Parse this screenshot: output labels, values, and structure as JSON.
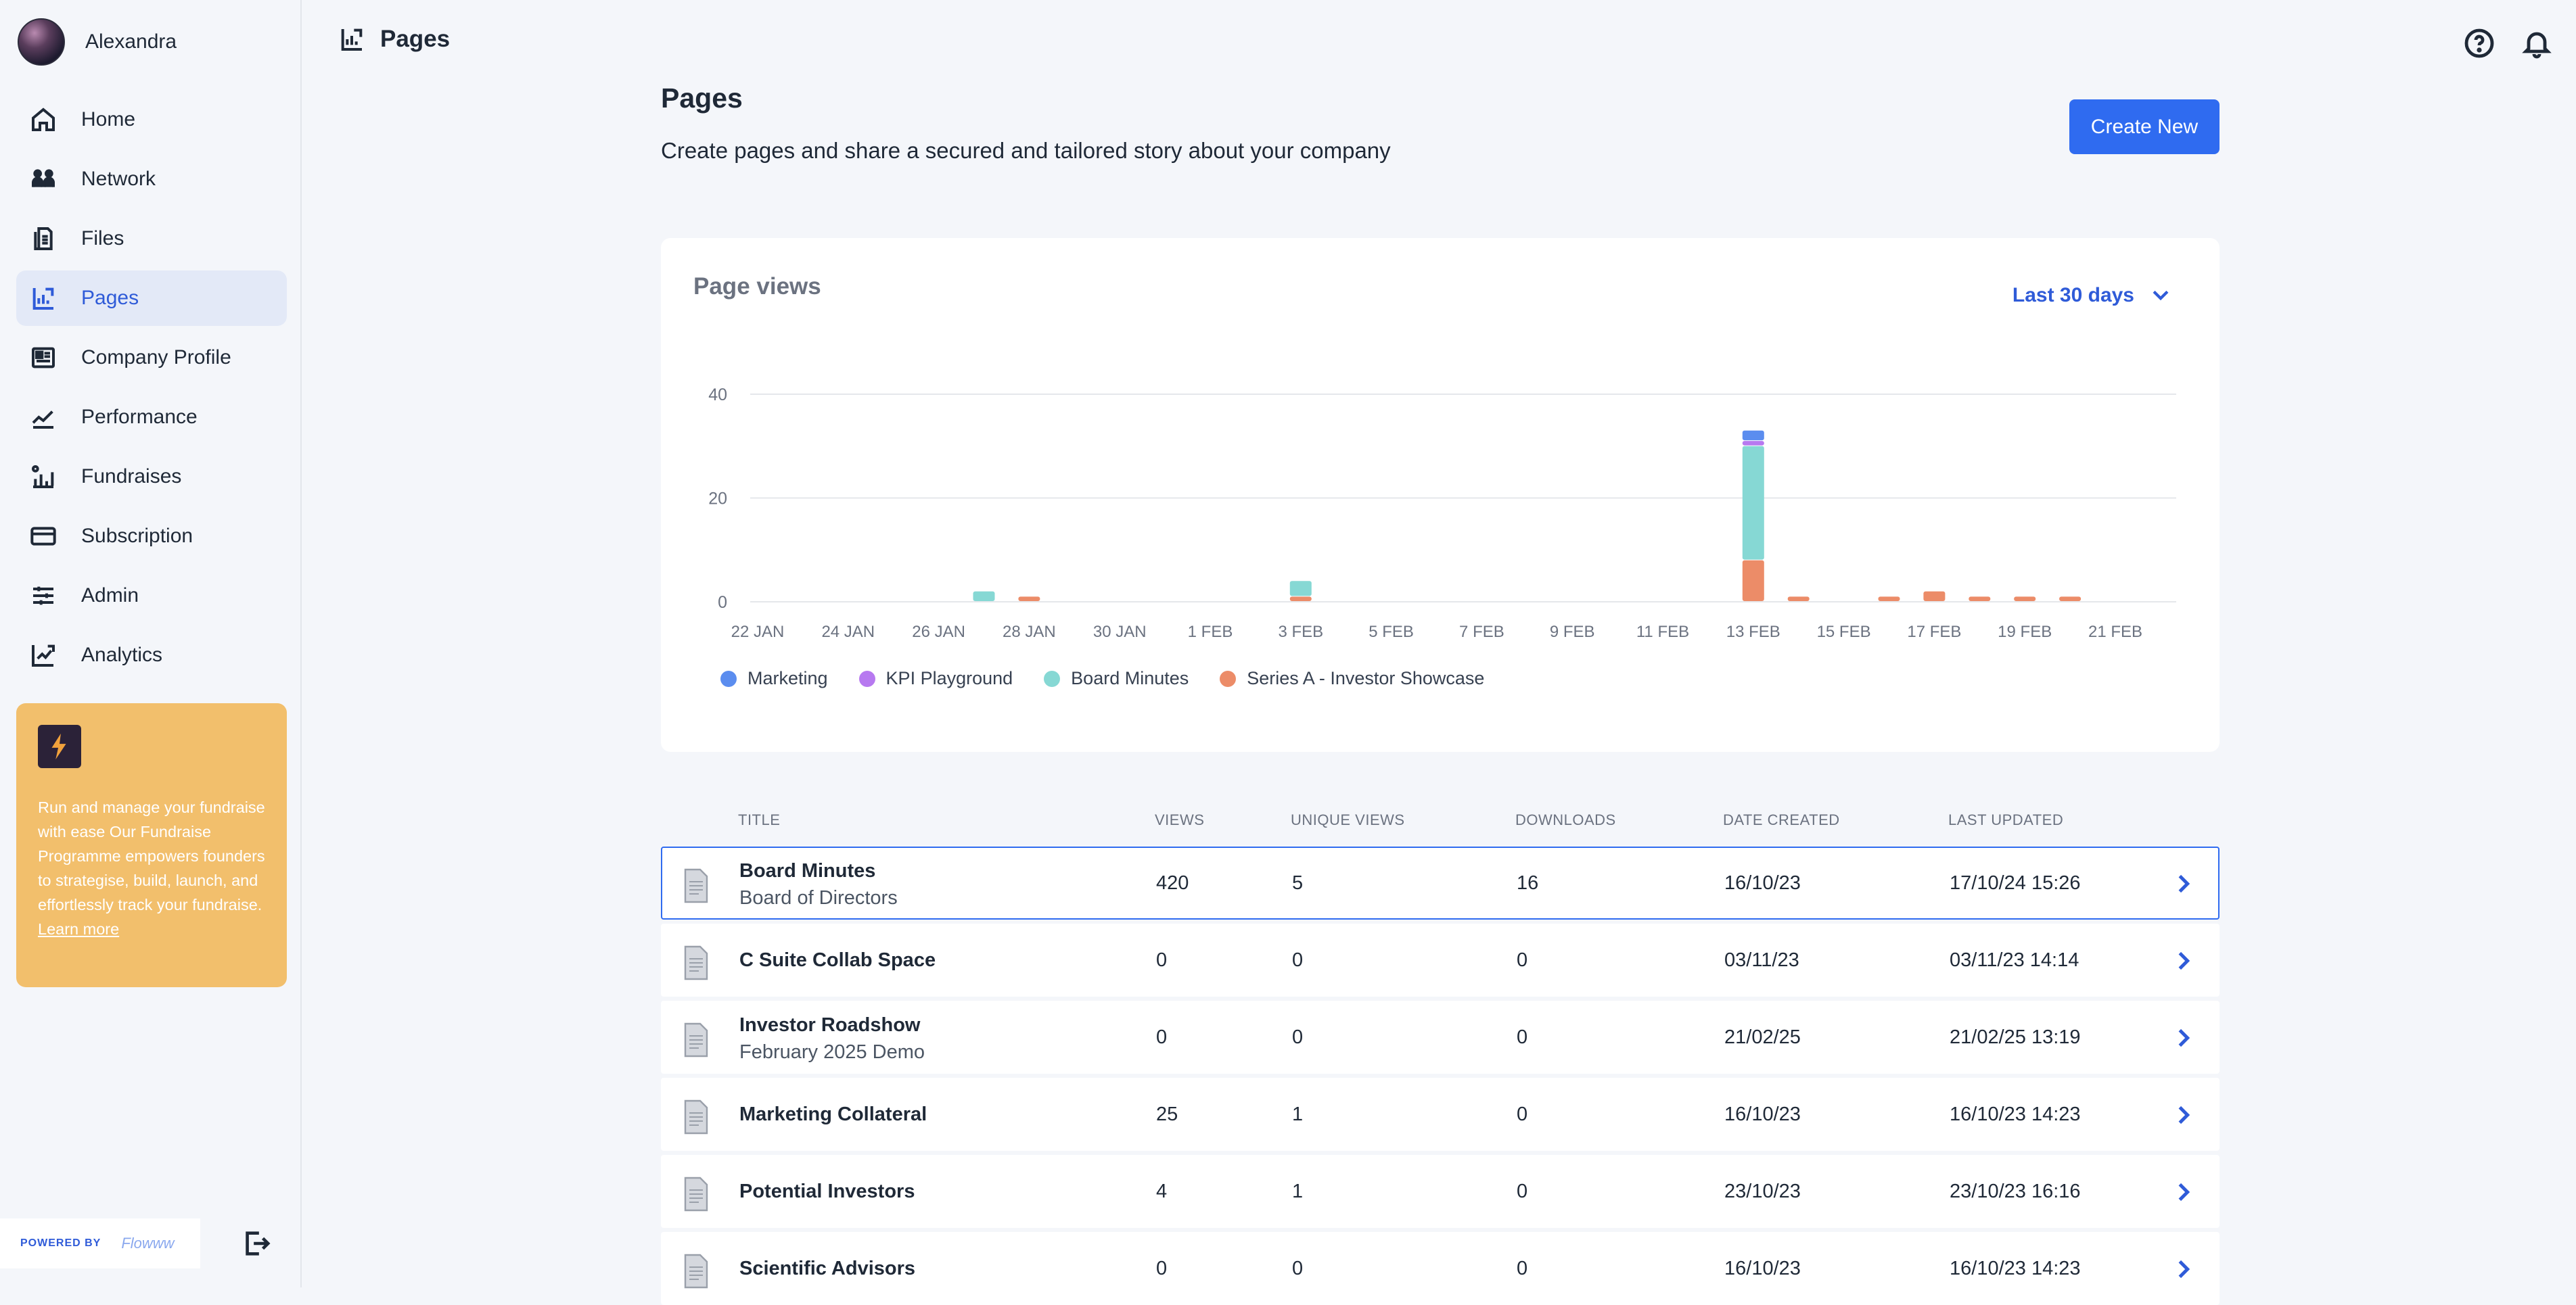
{
  "user": {
    "name": "Alexandra"
  },
  "sidebar": {
    "items": [
      {
        "label": "Home",
        "icon": "home-icon"
      },
      {
        "label": "Network",
        "icon": "network-icon"
      },
      {
        "label": "Files",
        "icon": "files-icon"
      },
      {
        "label": "Pages",
        "icon": "pages-icon",
        "active": true
      },
      {
        "label": "Company Profile",
        "icon": "company-profile-icon"
      },
      {
        "label": "Performance",
        "icon": "performance-icon"
      },
      {
        "label": "Fundraises",
        "icon": "fundraises-icon"
      },
      {
        "label": "Subscription",
        "icon": "subscription-icon"
      },
      {
        "label": "Admin",
        "icon": "admin-icon"
      },
      {
        "label": "Analytics",
        "icon": "analytics-icon"
      }
    ],
    "promo": {
      "text": "Run and manage your fundraise with ease Our Fundraise Programme empowers founders to strategise, build, launch, and effortlessly track your fundraise.",
      "link": "Learn more"
    },
    "powered_by": "POWERED BY",
    "brand": "Flowww"
  },
  "topbar": {
    "title": "Pages"
  },
  "header": {
    "title": "Pages",
    "subtitle": "Create pages and share a secured and tailored story about your company",
    "create_label": "Create New"
  },
  "chart_card": {
    "title": "Page views",
    "range_label": "Last 30 days"
  },
  "colors": {
    "accent": "#2f6bf0",
    "marketing": "#5b8def",
    "kpi_playground": "#b779f0",
    "board_minutes": "#86d8d4",
    "series_a": "#ec8c68"
  },
  "chart_data": {
    "type": "bar",
    "stacked": true,
    "categories": [
      "22 JAN",
      "23 JAN",
      "24 JAN",
      "25 JAN",
      "26 JAN",
      "27 JAN",
      "28 JAN",
      "29 JAN",
      "30 JAN",
      "31 JAN",
      "1 FEB",
      "2 FEB",
      "3 FEB",
      "4 FEB",
      "5 FEB",
      "6 FEB",
      "7 FEB",
      "8 FEB",
      "9 FEB",
      "10 FEB",
      "11 FEB",
      "12 FEB",
      "13 FEB",
      "14 FEB",
      "15 FEB",
      "16 FEB",
      "17 FEB",
      "18 FEB",
      "19 FEB",
      "20 FEB",
      "21 FEB"
    ],
    "tick_labels": [
      "22 JAN",
      "24 JAN",
      "26 JAN",
      "28 JAN",
      "30 JAN",
      "1 FEB",
      "3 FEB",
      "5 FEB",
      "7 FEB",
      "9 FEB",
      "11 FEB",
      "13 FEB",
      "15 FEB",
      "17 FEB",
      "19 FEB",
      "21 FEB"
    ],
    "series": [
      {
        "name": "Series A - Investor Showcase",
        "color": "#ec8c68",
        "values": [
          0,
          0,
          0,
          0,
          0,
          0,
          1,
          0,
          0,
          0,
          0,
          0,
          1,
          0,
          0,
          0,
          0,
          0,
          0,
          0,
          0,
          0,
          8,
          1,
          0,
          1,
          2,
          1,
          1,
          1,
          0
        ]
      },
      {
        "name": "Board Minutes",
        "color": "#86d8d4",
        "values": [
          0,
          0,
          0,
          0,
          0,
          2,
          0,
          0,
          0,
          0,
          0,
          0,
          3,
          0,
          0,
          0,
          0,
          0,
          0,
          0,
          0,
          0,
          22,
          0,
          0,
          0,
          0,
          0,
          0,
          0,
          0
        ]
      },
      {
        "name": "KPI Playground",
        "color": "#b779f0",
        "values": [
          0,
          0,
          0,
          0,
          0,
          0,
          0,
          0,
          0,
          0,
          0,
          0,
          0,
          0,
          0,
          0,
          0,
          0,
          0,
          0,
          0,
          0,
          1,
          0,
          0,
          0,
          0,
          0,
          0,
          0,
          0
        ]
      },
      {
        "name": "Marketing",
        "color": "#5b8def",
        "values": [
          0,
          0,
          0,
          0,
          0,
          0,
          0,
          0,
          0,
          0,
          0,
          0,
          0,
          0,
          0,
          0,
          0,
          0,
          0,
          0,
          0,
          0,
          2,
          0,
          0,
          0,
          0,
          0,
          0,
          0,
          0
        ]
      }
    ],
    "legend_order": [
      "Marketing",
      "KPI Playground",
      "Board Minutes",
      "Series A - Investor Showcase"
    ],
    "yticks": [
      0,
      20,
      40
    ],
    "ylim": [
      0,
      40
    ],
    "grid": true,
    "legend_position": "bottom-left"
  },
  "table": {
    "columns": [
      "TITLE",
      "VIEWS",
      "UNIQUE VIEWS",
      "DOWNLOADS",
      "DATE CREATED",
      "LAST UPDATED"
    ],
    "rows": [
      {
        "title": "Board Minutes",
        "subtitle": "Board of Directors",
        "views": "420",
        "unique": "5",
        "downloads": "16",
        "created": "16/10/23",
        "updated": "17/10/24 15:26",
        "selected": true
      },
      {
        "title": "C Suite Collab Space",
        "subtitle": "",
        "views": "0",
        "unique": "0",
        "downloads": "0",
        "created": "03/11/23",
        "updated": "03/11/23 14:14"
      },
      {
        "title": "Investor Roadshow",
        "subtitle": "February 2025 Demo",
        "views": "0",
        "unique": "0",
        "downloads": "0",
        "created": "21/02/25",
        "updated": "21/02/25 13:19"
      },
      {
        "title": "Marketing Collateral",
        "subtitle": "",
        "views": "25",
        "unique": "1",
        "downloads": "0",
        "created": "16/10/23",
        "updated": "16/10/23 14:23"
      },
      {
        "title": "Potential Investors",
        "subtitle": "",
        "views": "4",
        "unique": "1",
        "downloads": "0",
        "created": "23/10/23",
        "updated": "23/10/23 16:16"
      },
      {
        "title": "Scientific Advisors",
        "subtitle": "",
        "views": "0",
        "unique": "0",
        "downloads": "0",
        "created": "16/10/23",
        "updated": "16/10/23 14:23"
      }
    ]
  }
}
